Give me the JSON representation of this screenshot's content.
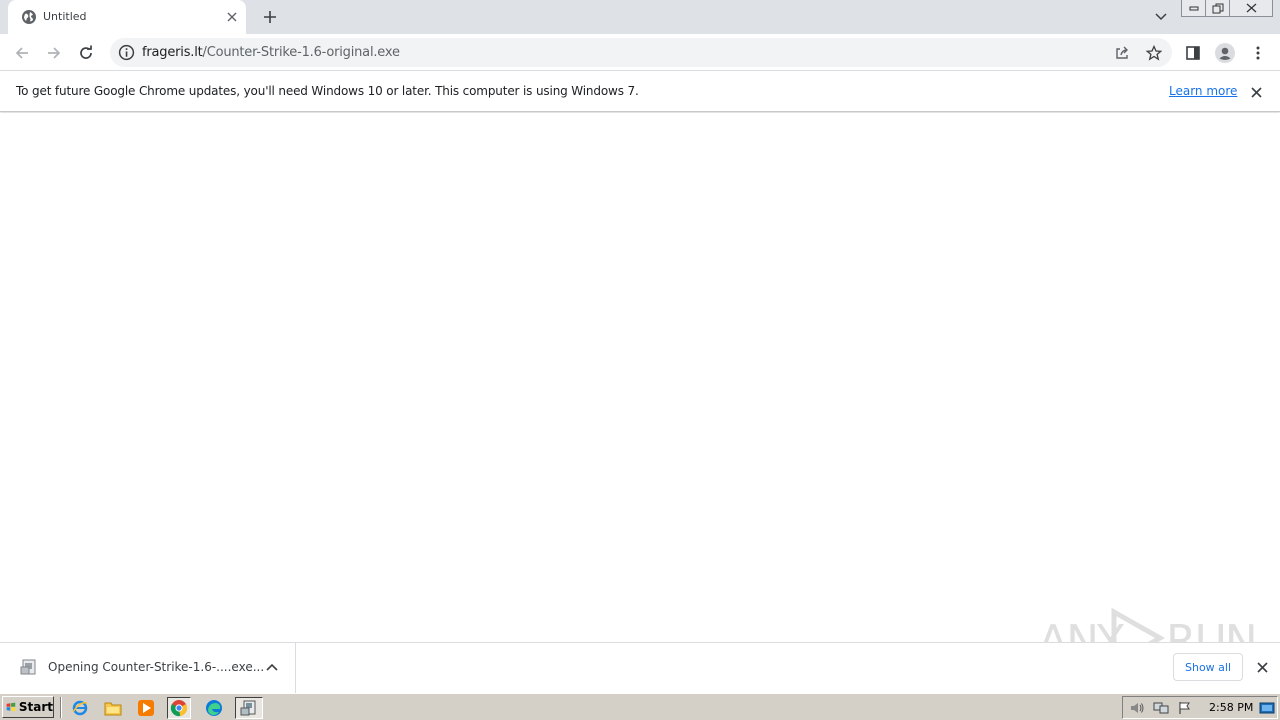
{
  "tabs": [
    {
      "title": "Untitled",
      "icon": "globe-icon"
    }
  ],
  "toolbar": {
    "url_host": "frageris.lt",
    "url_path": "/Counter-Strike-1.6-original.exe"
  },
  "infobar": {
    "message": "To get future Google Chrome updates, you'll need Windows 10 or later. This computer is using Windows 7.",
    "link_label": "Learn more"
  },
  "download_shelf": {
    "item_text": "Opening Counter-Strike-1.6-....exe...",
    "show_all_label": "Show all"
  },
  "watermark": {
    "left_text": "ANY",
    "right_text": "RUN"
  },
  "taskbar": {
    "start_label": "Start",
    "clock": "2:58 PM",
    "pinned": [
      "ie-icon",
      "folder-icon",
      "media-player-icon",
      "chrome-icon",
      "edge-icon",
      "installer-icon"
    ]
  },
  "colors": {
    "accent": "#1a73e8",
    "tabstrip_bg": "#dee1e6",
    "omnibox_bg": "#f1f3f4",
    "taskbar_bg": "#d4d0c8"
  }
}
